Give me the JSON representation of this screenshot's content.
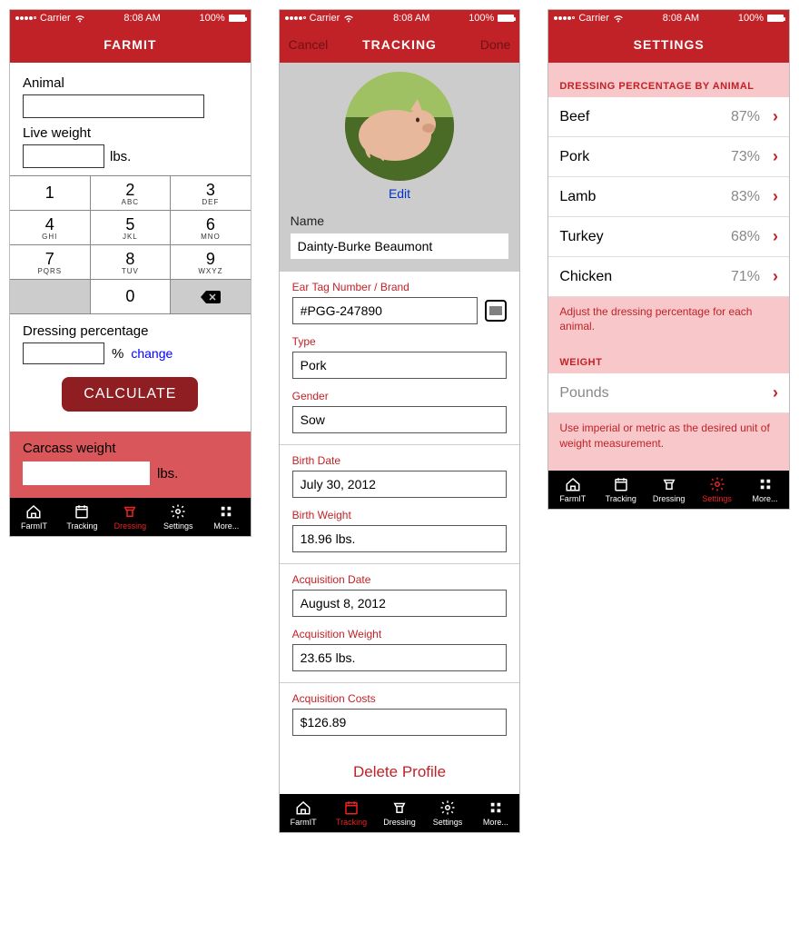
{
  "statusbar": {
    "carrier": "Carrier",
    "time": "8:08 AM",
    "battery": "100%"
  },
  "tabs": {
    "farmit": "FarmIT",
    "tracking": "Tracking",
    "dressing": "Dressing",
    "settings": "Settings",
    "more": "More..."
  },
  "screen1": {
    "title": "FARMIT",
    "animal_label": "Animal",
    "live_label": "Live weight",
    "unit_lbs": "lbs.",
    "keypad": {
      "k1": "1",
      "k2": "2",
      "k3": "3",
      "k4": "4",
      "k5": "5",
      "k6": "6",
      "k7": "7",
      "k8": "8",
      "k9": "9",
      "k0": "0",
      "abc": "ABC",
      "def": "DEF",
      "ghi": "GHI",
      "jkl": "JKL",
      "mno": "MNO",
      "pqrs": "PQRS",
      "tuv": "TUV",
      "wxyz": "WXYZ"
    },
    "dress_label": "Dressing percentage",
    "pct": "%",
    "change": "change",
    "calculate": "CALCULATE",
    "carcass_label": "Carcass weight"
  },
  "screen2": {
    "title": "TRACKING",
    "cancel": "Cancel",
    "done": "Done",
    "edit": "Edit",
    "name_label": "Name",
    "name_value": "Dainty-Burke Beaumont",
    "eartag_label": "Ear Tag Number / Brand",
    "eartag_value": "#PGG-247890",
    "type_label": "Type",
    "type_value": "Pork",
    "gender_label": "Gender",
    "gender_value": "Sow",
    "birth_date_label": "Birth Date",
    "birth_date_value": "July 30, 2012",
    "birth_weight_label": "Birth Weight",
    "birth_weight_value": "18.96 lbs.",
    "acq_date_label": "Acquisition Date",
    "acq_date_value": "August 8, 2012",
    "acq_weight_label": "Acquisition Weight",
    "acq_weight_value": "23.65 lbs.",
    "acq_costs_label": "Acquisition Costs",
    "acq_costs_value": "$126.89",
    "delete": "Delete Profile"
  },
  "screen3": {
    "title": "SETTINGS",
    "hdr_dressing": "DRESSING PERCENTAGE BY ANIMAL",
    "rows": [
      {
        "name": "Beef",
        "pct": "87%"
      },
      {
        "name": "Pork",
        "pct": "73%"
      },
      {
        "name": "Lamb",
        "pct": "83%"
      },
      {
        "name": "Turkey",
        "pct": "68%"
      },
      {
        "name": "Chicken",
        "pct": "71%"
      }
    ],
    "note_dressing": "Adjust the dressing percentage for each animal.",
    "hdr_weight": "WEIGHT",
    "weight_unit": "Pounds",
    "note_weight": "Use imperial or metric as the desired unit of weight measurement."
  }
}
